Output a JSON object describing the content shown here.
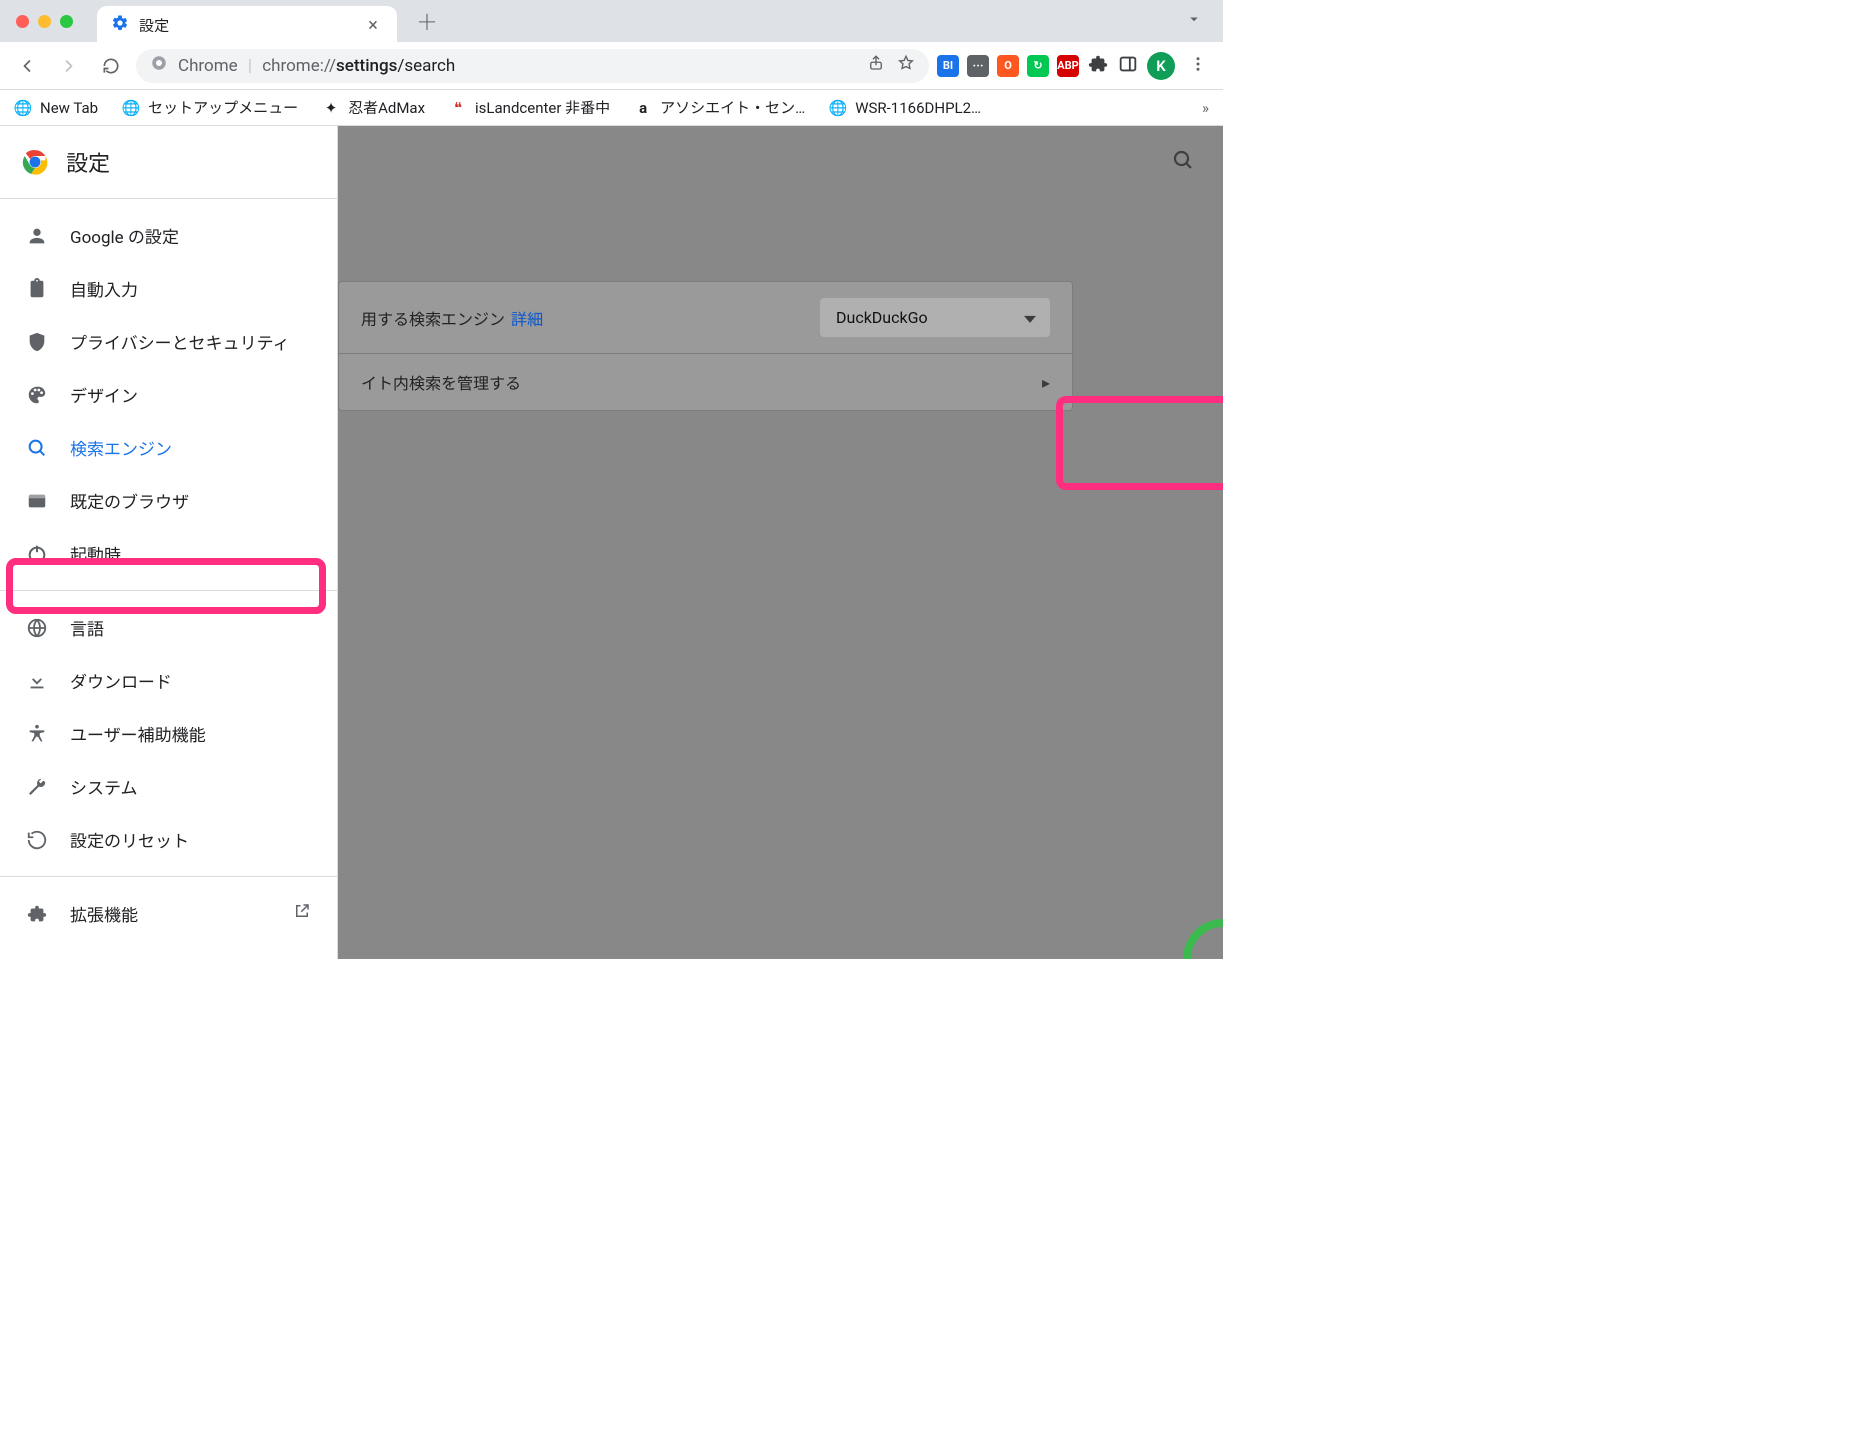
{
  "tab": {
    "title": "設定"
  },
  "url": {
    "chip": "Chrome",
    "full": "chrome://settings/search"
  },
  "avatar": {
    "initial": "K"
  },
  "bookmarks": [
    {
      "label": "New Tab",
      "icon": "globe"
    },
    {
      "label": "セットアップメニュー",
      "icon": "globe"
    },
    {
      "label": "忍者AdMax",
      "icon": "ninja"
    },
    {
      "label": "isLandcenter 非番中",
      "icon": "quote"
    },
    {
      "label": "アソシエイト・セン…",
      "icon": "amazon"
    },
    {
      "label": "WSR-1166DHPL2…",
      "icon": "globe"
    }
  ],
  "settings_title": "設定",
  "sidebar": {
    "primary": [
      {
        "key": "google",
        "label": "Google の設定"
      },
      {
        "key": "autofill",
        "label": "自動入力"
      },
      {
        "key": "privacy",
        "label": "プライバシーとセキュリティ"
      },
      {
        "key": "design",
        "label": "デザイン"
      },
      {
        "key": "search",
        "label": "検索エンジン",
        "active": true
      },
      {
        "key": "default",
        "label": "既定のブラウザ"
      },
      {
        "key": "startup",
        "label": "起動時"
      }
    ],
    "secondary": [
      {
        "key": "language",
        "label": "言語"
      },
      {
        "key": "download",
        "label": "ダウンロード"
      },
      {
        "key": "a11y",
        "label": "ユーザー補助機能"
      },
      {
        "key": "system",
        "label": "システム"
      },
      {
        "key": "reset",
        "label": "設定のリセット"
      }
    ],
    "ext": {
      "label": "拡張機能"
    }
  },
  "content": {
    "row1_text": "用する検索エンジン",
    "row1_link": "詳細",
    "row1_select": "DuckDuckGo",
    "row2_text": "イト内検索を管理する"
  }
}
